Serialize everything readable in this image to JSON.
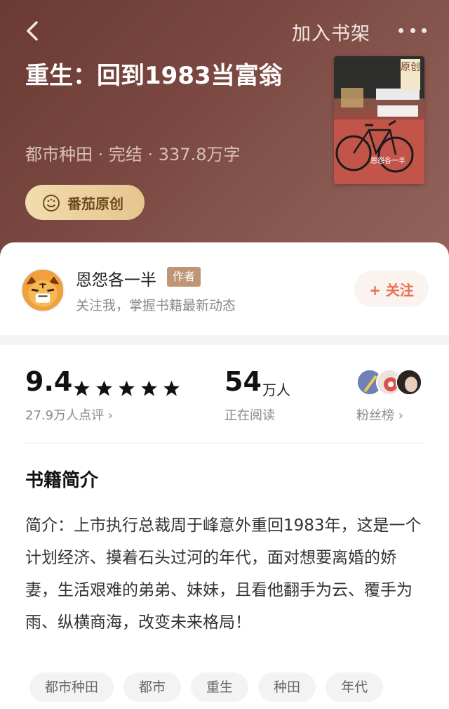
{
  "header": {
    "add_to_shelf": "加入书架",
    "back_icon": "back-chevron-icon",
    "more_icon": "more-dots-icon"
  },
  "book": {
    "title": "重生：回到1983当富翁",
    "meta": "都市种田 · 完结 · 337.8万字",
    "badge": "番茄原创",
    "cover_tag": "原创",
    "cover_author": "恩怨各一半"
  },
  "author": {
    "name": "恩怨各一半",
    "role_tag": "作者",
    "subtitle": "关注我，掌握书籍最新动态",
    "follow_label": "+ 关注"
  },
  "stats": {
    "score": "9.4",
    "stars": 5,
    "reviews": "27.9万人点评 ›",
    "readers_num": "54",
    "readers_unit": "万人",
    "readers_label": "正在阅读",
    "fans_label": "粉丝榜 ›"
  },
  "intro": {
    "title": "书籍简介",
    "text": "简介：上市执行总裁周于峰意外重回1983年，这是一个计划经济、摸着石头过河的年代，面对想要离婚的娇妻，生活艰难的弟弟、妹妹，且看他翻手为云、覆手为雨、纵横商海，改变未来格局！"
  },
  "tags": [
    "都市种田",
    "都市",
    "重生",
    "种田",
    "年代"
  ],
  "colors": {
    "hero_bg": "#7a4840",
    "badge_gold": "#e6c58e",
    "accent_orange": "#e8714f",
    "author_tag": "#c09476"
  }
}
